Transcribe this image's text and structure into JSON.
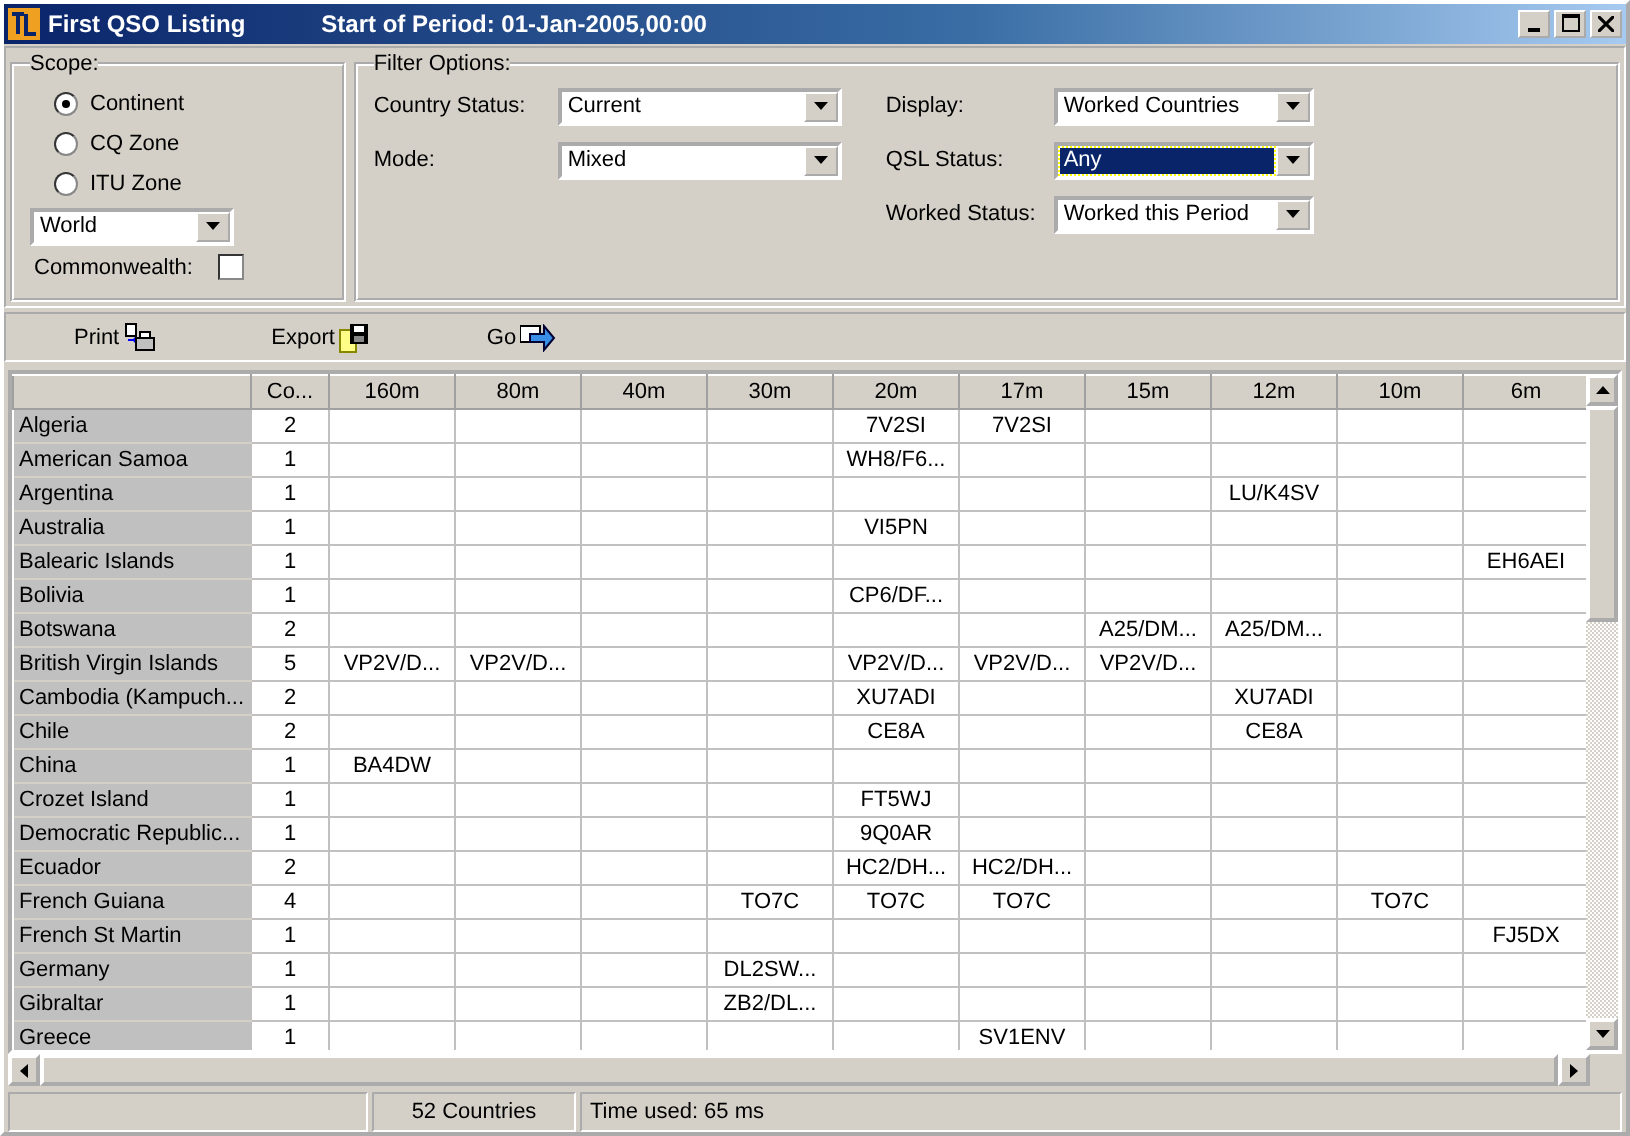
{
  "window": {
    "title": "First QSO Listing",
    "subtitle": "Start of Period: 01-Jan-2005,00:00"
  },
  "scope": {
    "legend": "Scope:",
    "options": [
      {
        "label": "Continent",
        "selected": true
      },
      {
        "label": "CQ Zone",
        "selected": false
      },
      {
        "label": "ITU Zone",
        "selected": false
      }
    ],
    "region": {
      "value": "World"
    },
    "commonwealth": {
      "label": "Commonwealth:",
      "checked": false
    }
  },
  "filter": {
    "legend": "Filter Options:",
    "fields": [
      {
        "label": "Country Status:",
        "value": "Current",
        "focused": false
      },
      {
        "label": "Mode:",
        "value": "Mixed",
        "focused": false
      },
      {
        "label": "Display:",
        "value": "Worked Countries",
        "focused": false
      },
      {
        "label": "QSL Status:",
        "value": "Any",
        "focused": true
      },
      {
        "label": "Worked Status:",
        "value": "Worked this Period",
        "focused": false
      }
    ]
  },
  "toolbar": [
    {
      "label": "Print",
      "kind": "print"
    },
    {
      "label": "Export",
      "kind": "export"
    },
    {
      "label": "Go",
      "kind": "go"
    }
  ],
  "table": {
    "columns": [
      "",
      "Co...",
      "160m",
      "80m",
      "40m",
      "30m",
      "20m",
      "17m",
      "15m",
      "12m",
      "10m",
      "6m"
    ],
    "rows": [
      {
        "cells": [
          "Algeria",
          "2",
          "",
          "",
          "",
          "",
          "7V2SI",
          "7V2SI",
          "",
          "",
          "",
          ""
        ]
      },
      {
        "cells": [
          "American Samoa",
          "1",
          "",
          "",
          "",
          "",
          "WH8/F6...",
          "",
          "",
          "",
          "",
          ""
        ]
      },
      {
        "cells": [
          "Argentina",
          "1",
          "",
          "",
          "",
          "",
          "",
          "",
          "",
          "LU/K4SV",
          "",
          ""
        ]
      },
      {
        "cells": [
          "Australia",
          "1",
          "",
          "",
          "",
          "",
          "VI5PN",
          "",
          "",
          "",
          "",
          ""
        ]
      },
      {
        "cells": [
          "Balearic Islands",
          "1",
          "",
          "",
          "",
          "",
          "",
          "",
          "",
          "",
          "",
          "EH6AEI"
        ]
      },
      {
        "cells": [
          "Bolivia",
          "1",
          "",
          "",
          "",
          "",
          "CP6/DF...",
          "",
          "",
          "",
          "",
          ""
        ]
      },
      {
        "cells": [
          "Botswana",
          "2",
          "",
          "",
          "",
          "",
          "",
          "",
          "A25/DM...",
          "A25/DM...",
          "",
          ""
        ]
      },
      {
        "cells": [
          "British Virgin Islands",
          "5",
          "VP2V/D...",
          "VP2V/D...",
          "",
          "",
          "VP2V/D...",
          "VP2V/D...",
          "VP2V/D...",
          "",
          "",
          ""
        ]
      },
      {
        "cells": [
          "Cambodia (Kampuch...",
          "2",
          "",
          "",
          "",
          "",
          "XU7ADI",
          "",
          "",
          "XU7ADI",
          "",
          ""
        ]
      },
      {
        "cells": [
          "Chile",
          "2",
          "",
          "",
          "",
          "",
          "CE8A",
          "",
          "",
          "CE8A",
          "",
          ""
        ]
      },
      {
        "cells": [
          "China",
          "1",
          "BA4DW",
          "",
          "",
          "",
          "",
          "",
          "",
          "",
          "",
          ""
        ]
      },
      {
        "cells": [
          "Crozet Island",
          "1",
          "",
          "",
          "",
          "",
          "FT5WJ",
          "",
          "",
          "",
          "",
          ""
        ]
      },
      {
        "cells": [
          "Democratic Republic...",
          "1",
          "",
          "",
          "",
          "",
          "9Q0AR",
          "",
          "",
          "",
          "",
          ""
        ]
      },
      {
        "cells": [
          "Ecuador",
          "2",
          "",
          "",
          "",
          "",
          "HC2/DH...",
          "HC2/DH...",
          "",
          "",
          "",
          ""
        ]
      },
      {
        "cells": [
          "French Guiana",
          "4",
          "",
          "",
          "",
          "TO7C",
          "TO7C",
          "TO7C",
          "",
          "",
          "TO7C",
          ""
        ]
      },
      {
        "cells": [
          "French St Martin",
          "1",
          "",
          "",
          "",
          "",
          "",
          "",
          "",
          "",
          "",
          "FJ5DX"
        ]
      },
      {
        "cells": [
          "Germany",
          "1",
          "",
          "",
          "",
          "DL2SW...",
          "",
          "",
          "",
          "",
          "",
          ""
        ]
      },
      {
        "cells": [
          "Gibraltar",
          "1",
          "",
          "",
          "",
          "ZB2/DL...",
          "",
          "",
          "",
          "",
          "",
          ""
        ]
      },
      {
        "cells": [
          "Greece",
          "1",
          "",
          "",
          "",
          "",
          "",
          "SV1ENV",
          "",
          "",
          "",
          ""
        ]
      }
    ]
  },
  "status_bar": [
    "52 Countries",
    "Time used: 65 ms"
  ]
}
